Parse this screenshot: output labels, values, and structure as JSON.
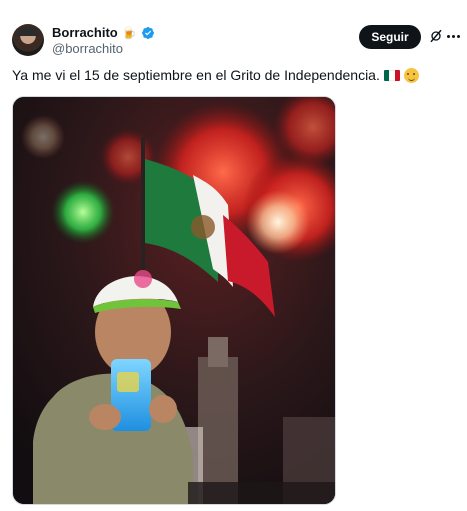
{
  "author": {
    "display_name": "Borrachito",
    "name_emoji": "🍺",
    "handle": "@borrachito",
    "verified": true
  },
  "actions": {
    "follow_label": "Seguir",
    "grok_icon": "grok-icon",
    "more_icon": "more-icon"
  },
  "tweet": {
    "text": "Ya me vi el 15 de septiembre en el Grito de Independencia.",
    "emojis": [
      "mexico-flag-emoji",
      "face-holding-back-tears-emoji"
    ]
  },
  "media": {
    "type": "photo",
    "description_icon": "fireworks-photo"
  },
  "colors": {
    "text": "#0f1419",
    "secondary_text": "#536471",
    "verified_blue": "#1d9bf0",
    "button_bg": "#0f1419"
  }
}
